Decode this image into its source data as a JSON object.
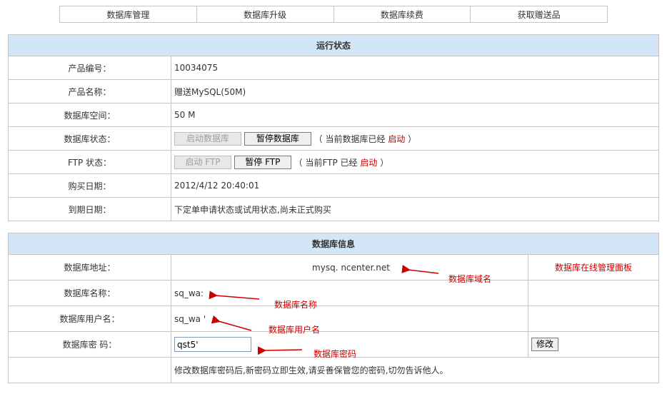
{
  "nav": {
    "items": [
      "数据库管理",
      "数据库升级",
      "数据库续费",
      "获取赠送品"
    ]
  },
  "status_panel": {
    "title": "运行状态",
    "rows": {
      "product_id": {
        "label": "产品编号：",
        "value": "10034075"
      },
      "product_name": {
        "label": "产品名称：",
        "value": "赠送MySQL(50M)"
      },
      "db_space": {
        "label": "数据库空间：",
        "value": "50 M"
      },
      "db_status": {
        "label": "数据库状态：",
        "start_button": "启动数据库",
        "stop_button": "暂停数据库",
        "note_prefix": "（ 当前数据库已经",
        "state": "启动",
        "note_suffix": "）"
      },
      "ftp_status": {
        "label": "FTP 状态：",
        "start_button": "启动 FTP",
        "stop_button": "暂停 FTP",
        "note_prefix": "（ 当前FTP 已经",
        "state": "启动",
        "note_suffix": "）"
      },
      "purchase_date": {
        "label": "购买日期：",
        "value": "2012/4/12 20:40:01"
      },
      "expire_date": {
        "label": "到期日期：",
        "value": "下定单申请状态或试用状态,尚未正式购买"
      }
    }
  },
  "info_panel": {
    "title": "数据库信息",
    "rows": {
      "address": {
        "label": "数据库地址：",
        "value": "mysq.              ncenter.net",
        "side_link": "数据库在线管理面板"
      },
      "db_name": {
        "label": "数据库名称：",
        "value": "sq_wa:"
      },
      "db_user": {
        "label": "数据库用户名：",
        "value": "sq_wa    '"
      },
      "password": {
        "label": "数据库密  码：",
        "input_value": "qst5'",
        "modify_button": "修改"
      },
      "footer_note": "修改数据库密码后,新密码立即生效,请妥善保管您的密码,切勿告诉他人。"
    }
  },
  "annotations": {
    "domain": "数据库域名",
    "name": "数据库名称",
    "user": "数据库用户名",
    "password": "数据库密码"
  },
  "colors": {
    "header_bg": "#d3e6f7",
    "border": "#c5c5c5",
    "accent_red": "#cc0000"
  }
}
